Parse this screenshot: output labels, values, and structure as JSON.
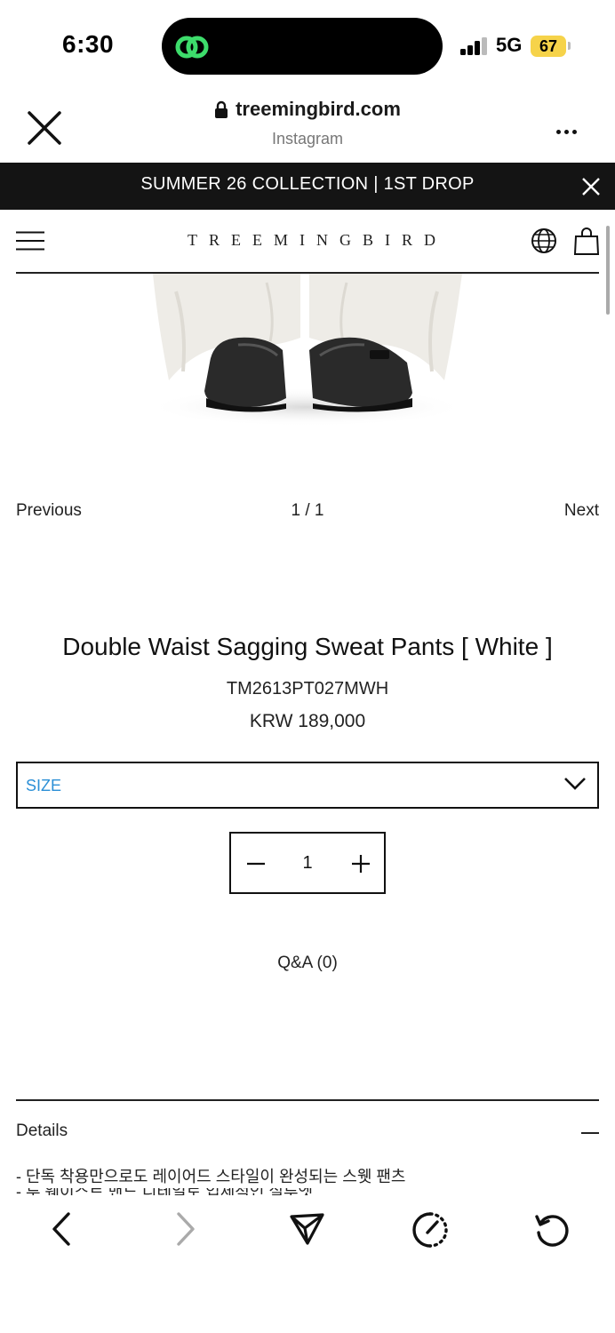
{
  "status_bar": {
    "time": "6:30",
    "network": "5G",
    "battery": "67",
    "battery_color": "#f6d34a",
    "island_icon": "link-app-icon"
  },
  "browser": {
    "domain": "treemingbird.com",
    "source": "Instagram",
    "close_icon": "close-icon",
    "lock_icon": "lock-icon",
    "more_icon": "more-icon"
  },
  "announcement": {
    "text": "SUMMER 26 COLLECTION | 1ST DROP"
  },
  "nav": {
    "logo": "TREEMINGBIRD",
    "menu_icon": "hamburger-icon",
    "language_icon": "globe-icon",
    "cart_icon": "shopping-bag-icon"
  },
  "gallery": {
    "previous": "Previous",
    "counter": "1 / 1",
    "next": "Next"
  },
  "product": {
    "name": "Double Waist Sagging Sweat Pants [ White ]",
    "code": "TM2613PT027MWH",
    "price": "KRW 189,000",
    "size_placeholder": "SIZE",
    "quantity": "1",
    "qna": "Q&A (0)"
  },
  "details": {
    "label": "Details",
    "line1": "- 단독 착용만으로도 레이어드 스타일이 완성되는 스웻 팬츠",
    "line2": "- 투 웨이스트 밴드 디테일로 입체적인 실루엣"
  },
  "toolbar": {
    "back_icon": "back-icon",
    "forward_icon": "forward-icon",
    "share_icon": "send-icon",
    "speed_icon": "speed-icon",
    "reload_icon": "reload-icon"
  }
}
